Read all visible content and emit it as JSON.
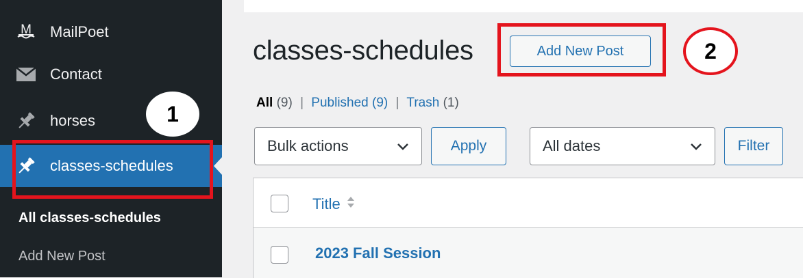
{
  "sidebar": {
    "items": [
      {
        "label": "MailPoet",
        "icon": "mailpoet-icon"
      },
      {
        "label": "Contact",
        "icon": "envelope-icon"
      },
      {
        "label": "horses",
        "icon": "pushpin-icon"
      },
      {
        "label": "classes-schedules",
        "icon": "pushpin-icon",
        "active": true
      }
    ],
    "submenu": [
      {
        "label": "All classes-schedules",
        "current": true
      },
      {
        "label": "Add New Post"
      }
    ]
  },
  "main": {
    "page_title": "classes-schedules",
    "add_new_label": "Add New Post",
    "views": {
      "all_label": "All",
      "all_count": "(9)",
      "published_label": "Published",
      "published_count": "(9)",
      "trash_label": "Trash",
      "trash_count": "(1)",
      "separator": "|"
    },
    "bulk_actions": {
      "selected": "Bulk actions"
    },
    "apply_label": "Apply",
    "dates_filter": {
      "selected": "All dates"
    },
    "filter_label": "Filter",
    "table": {
      "columns": [
        "Title"
      ],
      "rows": [
        {
          "title": "2023 Fall Session"
        }
      ]
    }
  },
  "annotations": {
    "callout_1": "1",
    "callout_2": "2",
    "highlight_color": "#e4141d"
  },
  "colors": {
    "sidebar_bg": "#1d2327",
    "active_bg": "#2271b1",
    "link": "#2271b1"
  }
}
